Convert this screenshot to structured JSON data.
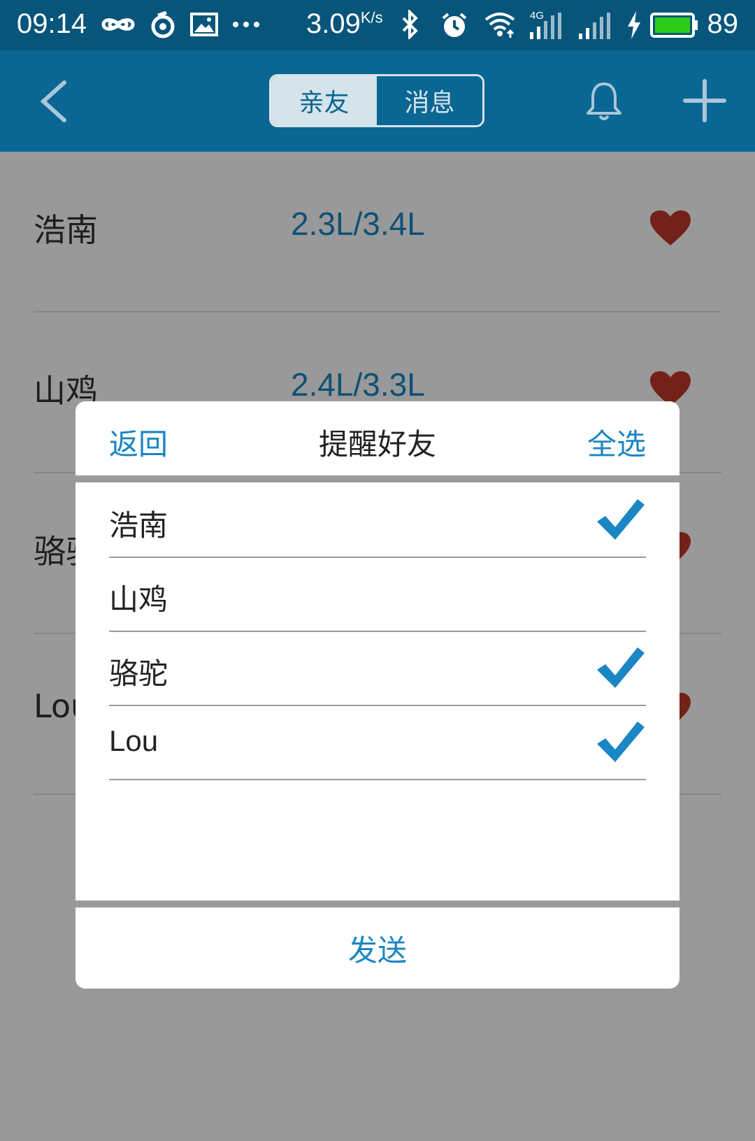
{
  "status_bar": {
    "time": "09:14",
    "speed": "3.09",
    "speed_unit": "K/s",
    "signal": "4G",
    "battery_pct": "89",
    "icons": [
      "infinity-icon",
      "netease-music-icon",
      "image-icon",
      "more-dots-icon",
      "bluetooth-icon",
      "alarm-icon",
      "wifi-icon",
      "cell-signal-icon",
      "cell-signal-2-icon",
      "charging-icon",
      "battery-icon"
    ]
  },
  "header": {
    "tabs": [
      {
        "label": "亲友",
        "active": true
      },
      {
        "label": "消息",
        "active": false
      }
    ],
    "icons": [
      "back-icon",
      "bell-icon",
      "plus-icon"
    ]
  },
  "friends": [
    {
      "name": "浩南",
      "usage": "2.3L/3.4L"
    },
    {
      "name": "山鸡",
      "usage": "2.4L/3.3L"
    },
    {
      "name": "骆驼",
      "usage": ""
    },
    {
      "name": "Lou",
      "usage": ""
    }
  ],
  "dialog": {
    "back_label": "返回",
    "title": "提醒好友",
    "select_all_label": "全选",
    "items": [
      {
        "name": "浩南",
        "checked": true
      },
      {
        "name": "山鸡",
        "checked": false
      },
      {
        "name": "骆驼",
        "checked": true
      },
      {
        "name": "Lou",
        "checked": true
      }
    ],
    "send_label": "发送"
  },
  "colors": {
    "header_bg": "#0a6693",
    "statusbar_bg": "#07557a",
    "accent": "#1a86c4",
    "heart": "#c0392b"
  }
}
